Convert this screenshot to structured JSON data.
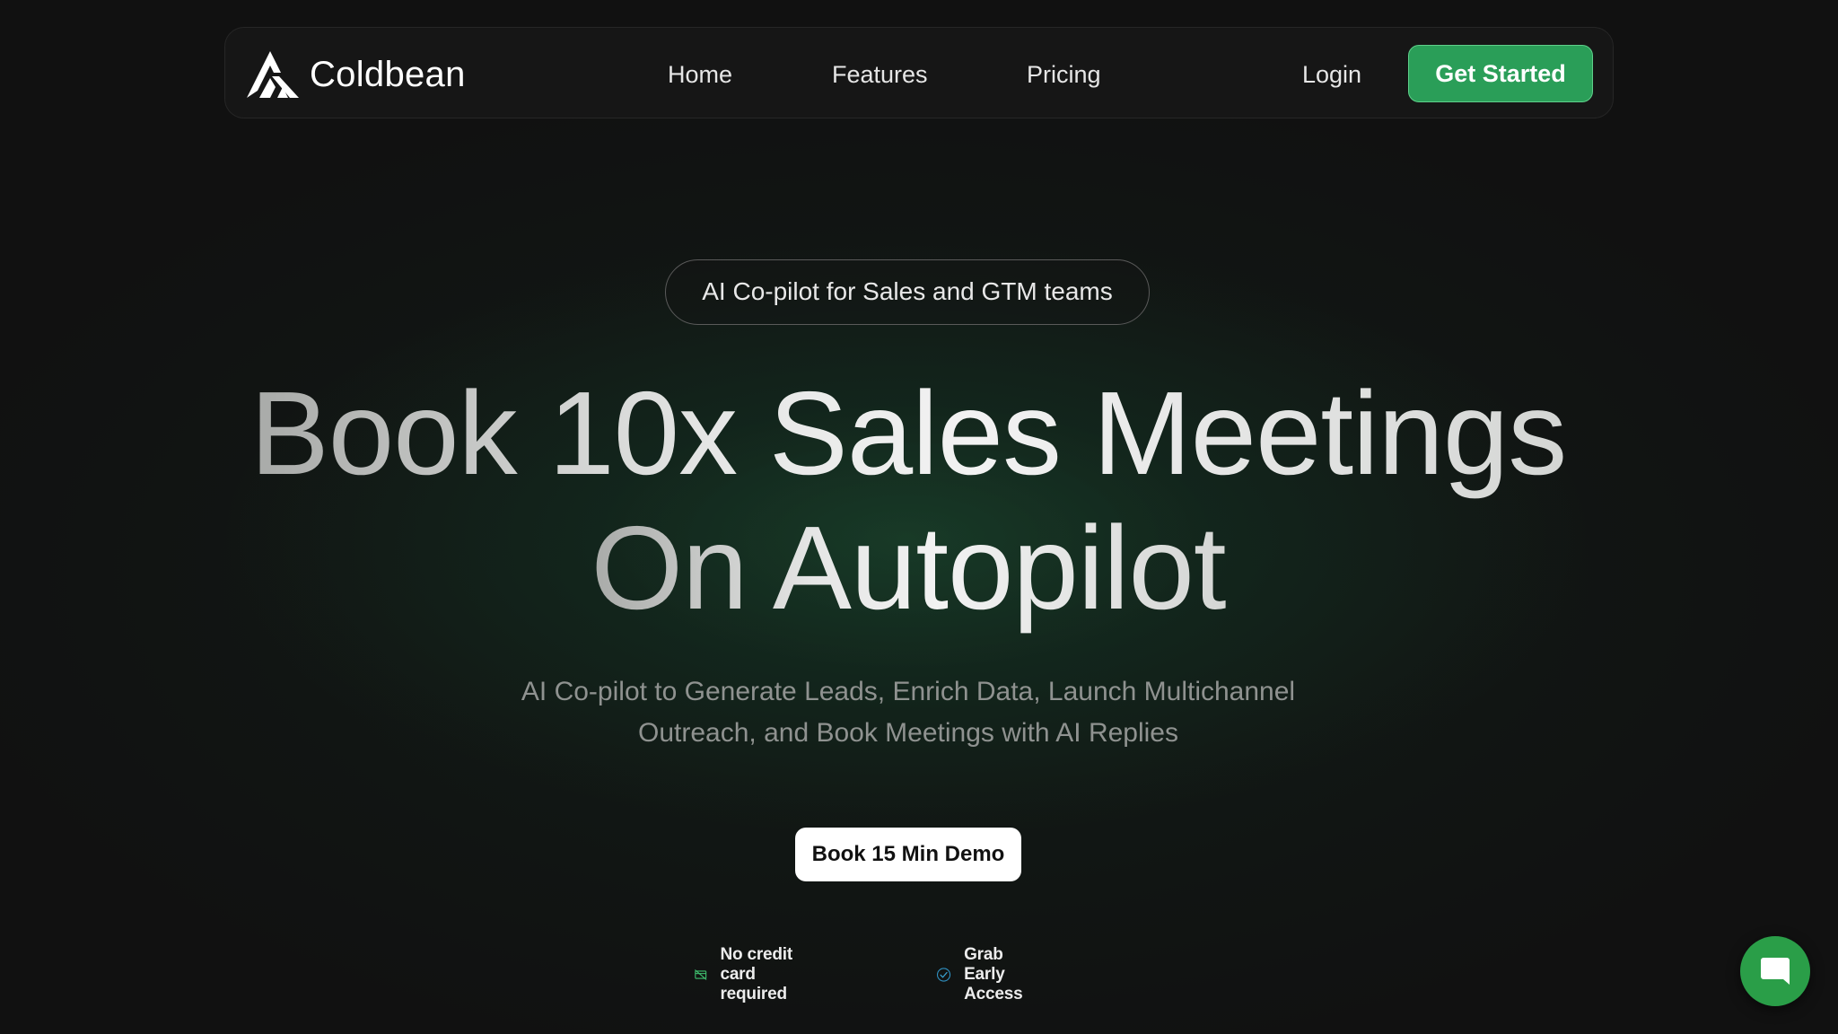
{
  "nav": {
    "brand": "Coldbean",
    "links": [
      "Home",
      "Features",
      "Pricing"
    ],
    "login": "Login",
    "cta": "Get Started"
  },
  "hero": {
    "badge": "AI Co-pilot for Sales and GTM teams",
    "headline_line1": "Book 10x Sales Meetings",
    "headline_line2": "On Autopilot",
    "subtitle_line1": "AI Co-pilot to Generate Leads, Enrich Data, Launch Multichannel",
    "subtitle_line2": "Outreach, and Book Meetings with AI Replies",
    "cta": "Book 15 Min Demo"
  },
  "perks": [
    {
      "icon": "no-credit-card-icon",
      "label": "No credit card required"
    },
    {
      "icon": "check-circle-icon",
      "label": "Grab Early Access"
    }
  ],
  "chat": {
    "icon": "chat-bubble-icon"
  },
  "colors": {
    "background": "#111111",
    "accent_green": "#2a9e58",
    "chat_green": "#2a9e48"
  }
}
